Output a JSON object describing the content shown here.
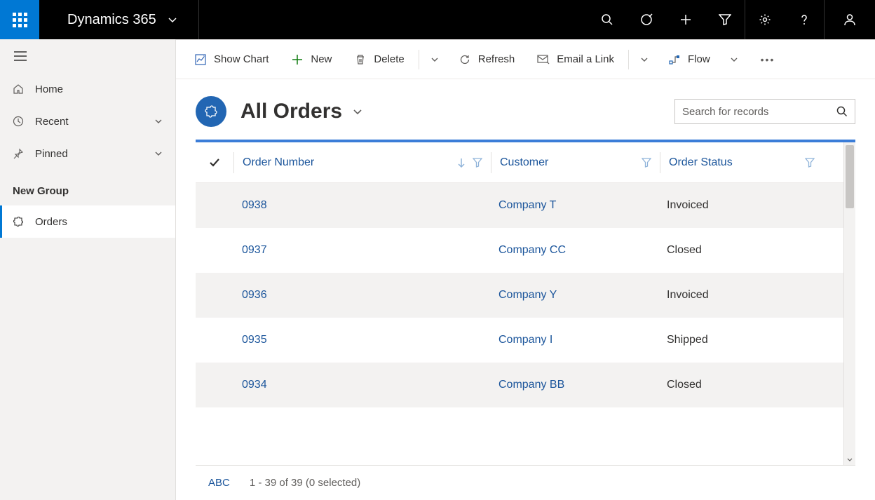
{
  "header": {
    "app_title": "Dynamics 365"
  },
  "sidebar": {
    "home": "Home",
    "recent": "Recent",
    "pinned": "Pinned",
    "group_label": "New Group",
    "orders": "Orders"
  },
  "commands": {
    "show_chart": "Show Chart",
    "new": "New",
    "delete": "Delete",
    "refresh": "Refresh",
    "email_link": "Email a Link",
    "flow": "Flow"
  },
  "view": {
    "title": "All Orders",
    "search_placeholder": "Search for records"
  },
  "grid": {
    "columns": {
      "order_number": "Order Number",
      "customer": "Customer",
      "order_status": "Order Status"
    },
    "rows": [
      {
        "order_number": "0938",
        "customer": "Company T",
        "status": "Invoiced"
      },
      {
        "order_number": "0937",
        "customer": "Company CC",
        "status": "Closed"
      },
      {
        "order_number": "0936",
        "customer": "Company Y",
        "status": "Invoiced"
      },
      {
        "order_number": "0935",
        "customer": "Company I",
        "status": "Shipped"
      },
      {
        "order_number": "0934",
        "customer": "Company BB",
        "status": "Closed"
      }
    ]
  },
  "footer": {
    "alpha": "ABC",
    "status": "1 - 39 of 39 (0 selected)"
  }
}
